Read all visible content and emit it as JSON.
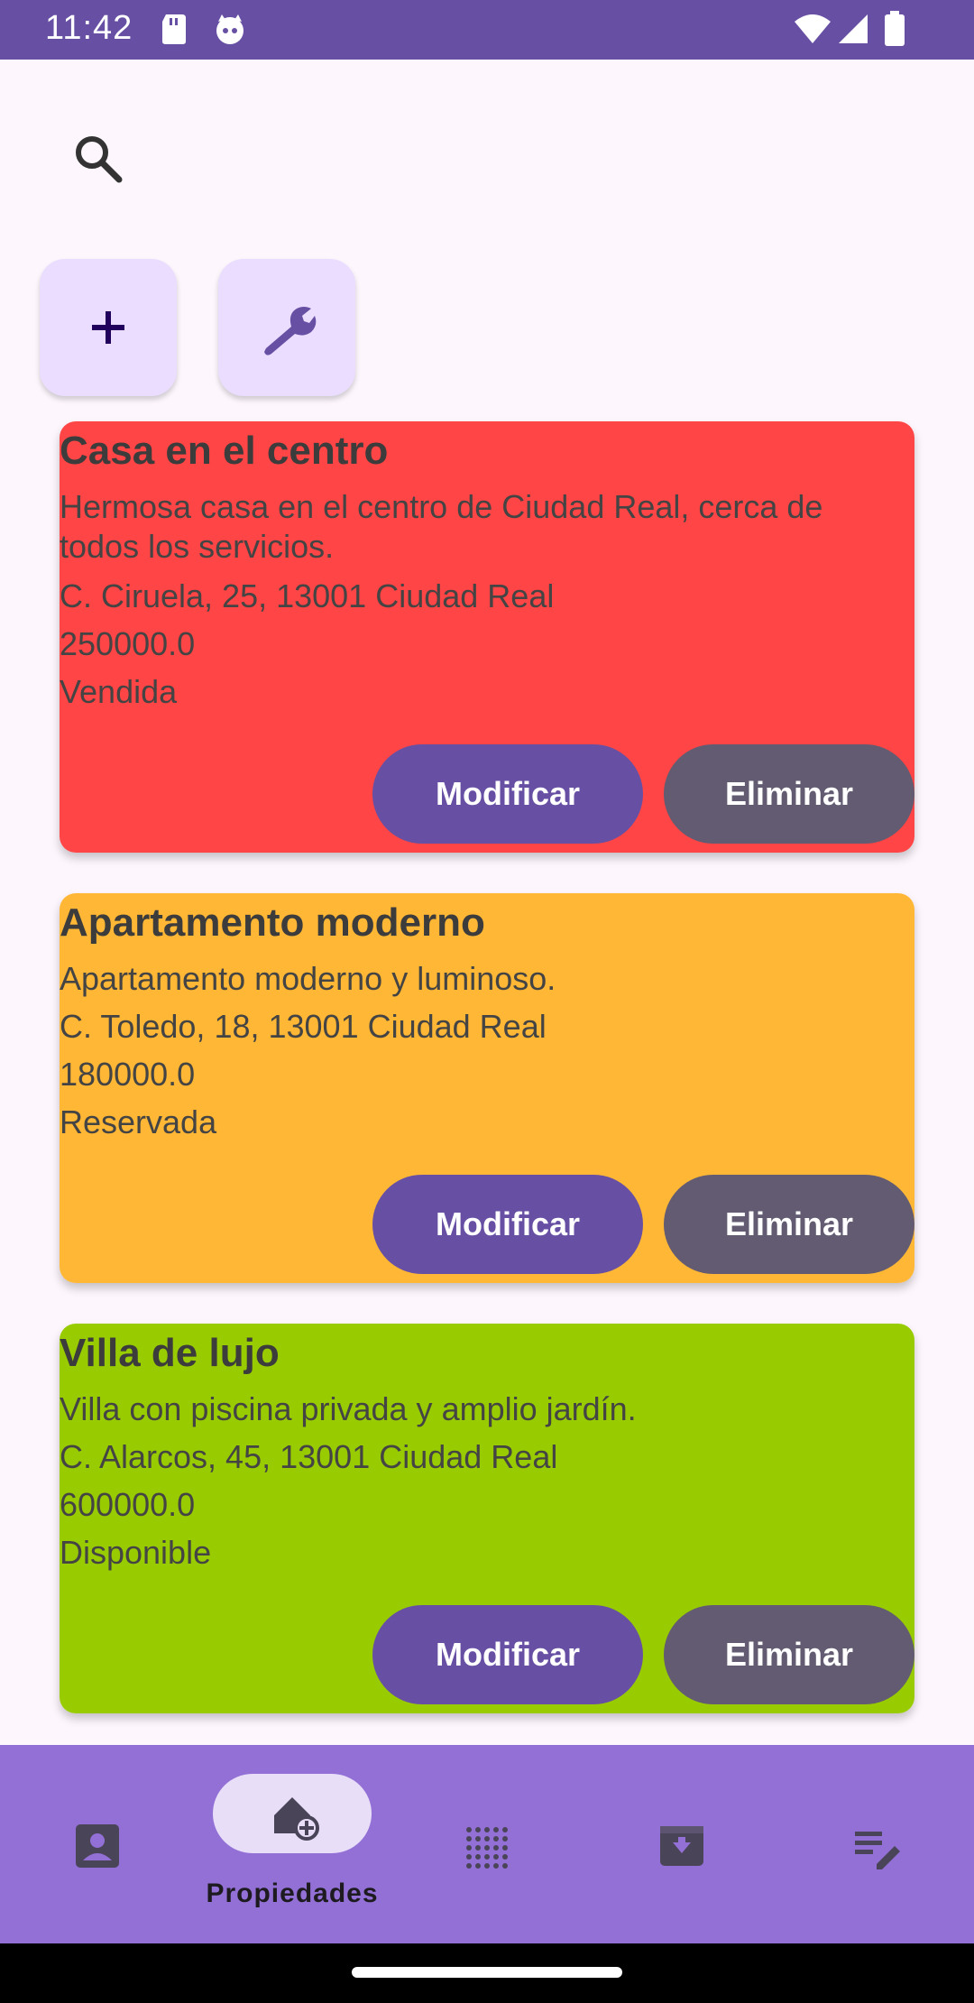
{
  "status_bar": {
    "time": "11:42"
  },
  "search": {
    "icon": "search-icon"
  },
  "top_actions": [
    {
      "icon": "plus-icon"
    },
    {
      "icon": "wrench-icon"
    }
  ],
  "properties": [
    {
      "title": "Casa en el centro",
      "description": "Hermosa casa en el centro de Ciudad Real, cerca de todos los servicios.",
      "address": "C. Ciruela, 25, 13001 Ciudad Real",
      "price": "250000.0",
      "status": "Vendida",
      "color": "#ff4545",
      "modify_label": "Modificar",
      "delete_label": "Eliminar"
    },
    {
      "title": "Apartamento moderno",
      "description": "Apartamento moderno y luminoso.",
      "address": "C. Toledo, 18, 13001 Ciudad Real",
      "price": "180000.0",
      "status": "Reservada",
      "color": "#ffb735",
      "modify_label": "Modificar",
      "delete_label": "Eliminar"
    },
    {
      "title": "Villa de lujo",
      "description": "Villa con piscina privada y amplio jardín.",
      "address": "C. Alarcos, 45, 13001 Ciudad Real",
      "price": "600000.0",
      "status": "Disponible",
      "color": "#99cc00",
      "modify_label": "Modificar",
      "delete_label": "Eliminar"
    }
  ],
  "bottom_nav": {
    "items": [
      {
        "icon": "contact-icon"
      },
      {
        "icon": "home-add-icon",
        "label": "Propiedades",
        "selected": true
      },
      {
        "icon": "dots-grid-icon"
      },
      {
        "icon": "archive-download-icon"
      },
      {
        "icon": "edit-list-icon"
      }
    ]
  },
  "colors": {
    "primary": "#6750a4",
    "secondary": "#625b71",
    "nav_background": "#9370d6",
    "fab_background": "#eaddff"
  }
}
